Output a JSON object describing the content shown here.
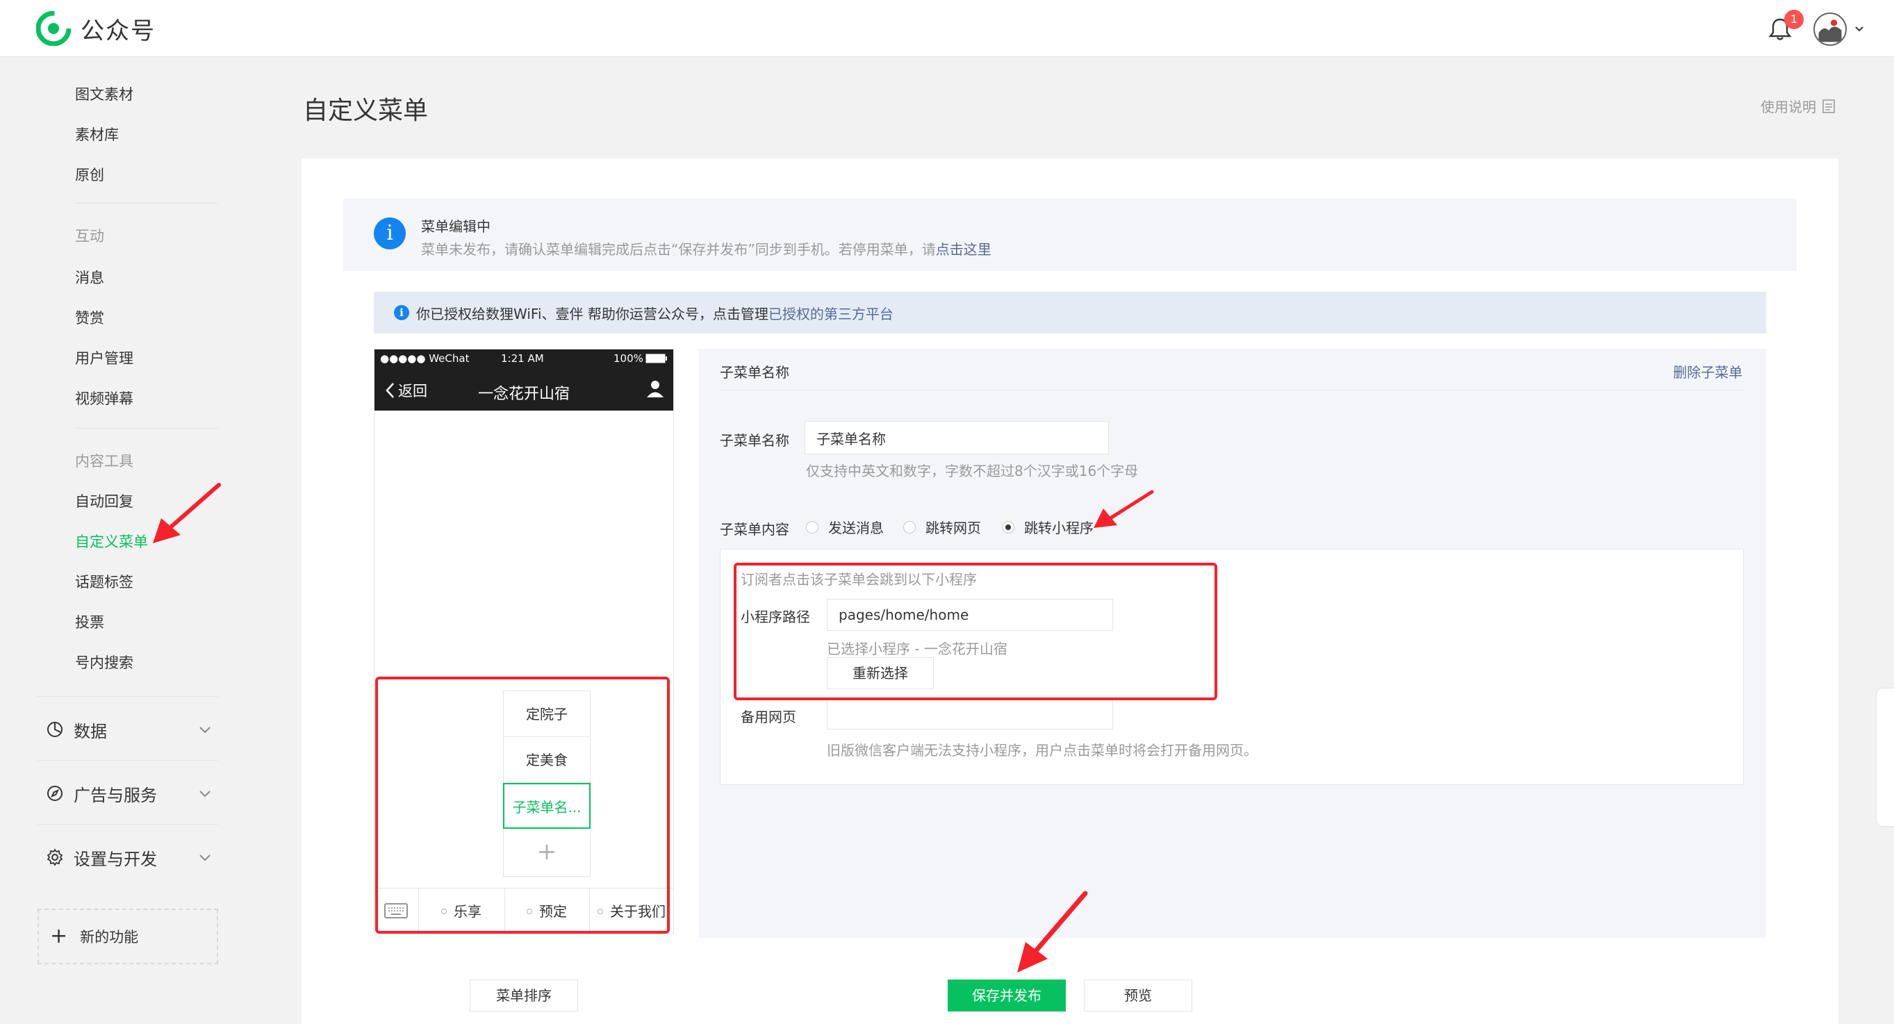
{
  "header": {
    "brand": "公众号",
    "notification_count": "1",
    "colors": {
      "brand": "#07c160",
      "badge": "#fa5151"
    }
  },
  "sidebar": {
    "items_top": [
      "图文素材",
      "素材库",
      "原创"
    ],
    "group_interaction": "互动",
    "items_interaction": [
      "消息",
      "赞赏",
      "用户管理",
      "视频弹幕"
    ],
    "group_content": "内容工具",
    "items_content": [
      "自动回复",
      "自定义菜单",
      "话题标签",
      "投票",
      "号内搜索"
    ],
    "active_item": "自定义菜单",
    "sections": [
      {
        "label": "数据",
        "icon": "pie-chart-icon"
      },
      {
        "label": "广告与服务",
        "icon": "compass-icon"
      },
      {
        "label": "设置与开发",
        "icon": "gear-icon"
      }
    ],
    "new_features": "新的功能"
  },
  "page": {
    "title": "自定义菜单",
    "help": "使用说明"
  },
  "notice_editing": {
    "title": "菜单编辑中",
    "text": "菜单未发布，请确认菜单编辑完成后点击“保存并发布”同步到手机。若停用菜单，请",
    "link": "点击这里"
  },
  "notice_auth": {
    "text": "你已授权给数狸WiFi、壹伴  帮助你运营公众号，点击管理",
    "link": "已授权的第三方平台"
  },
  "phone": {
    "carrier": "●●●●● WeChat",
    "time": "1:21 AM",
    "battery": "100%",
    "back": "返回",
    "account_name": "一念花开山宿",
    "submenu_items": [
      "定院子",
      "定美食",
      "子菜单名..."
    ],
    "submenu_add": "+",
    "menu_tabs": [
      "乐享",
      "预定",
      "关于我们"
    ]
  },
  "editor": {
    "header_title": "子菜单名称",
    "delete_link": "删除子菜单",
    "name_label": "子菜单名称",
    "name_value": "子菜单名称",
    "name_hint": "仅支持中英文和数字，字数不超过8个汉字或16个字母",
    "content_label": "子菜单内容",
    "content_options": [
      "发送消息",
      "跳转网页",
      "跳转小程序"
    ],
    "content_selected": "跳转小程序",
    "mp_intro": "订阅者点击该子菜单会跳到以下小程序",
    "mp_path_label": "小程序路径",
    "mp_path_value": "pages/home/home",
    "mp_selected": "已选择小程序 - 一念花开山宿",
    "reselect": "重新选择",
    "backup_label": "备用网页",
    "backup_value": "",
    "backup_hint": "旧版微信客户端无法支持小程序，用户点击菜单时将会打开备用网页。"
  },
  "footer": {
    "sort": "菜单排序",
    "save_publish": "保存并发布",
    "preview": "预览"
  }
}
